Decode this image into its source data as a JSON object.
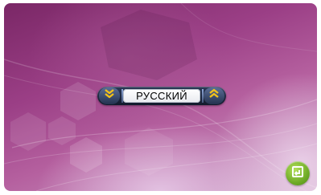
{
  "language_selector": {
    "value": "РУССКИЙ"
  },
  "icons": {
    "previous": "double-chevron-down-icon",
    "next": "double-chevron-up-icon",
    "back": "return-arrow-icon"
  },
  "colors": {
    "background": "#9b3f86",
    "selector": "#1d2740",
    "arrow": "#f2c21a",
    "back_button": "#6fab27"
  }
}
